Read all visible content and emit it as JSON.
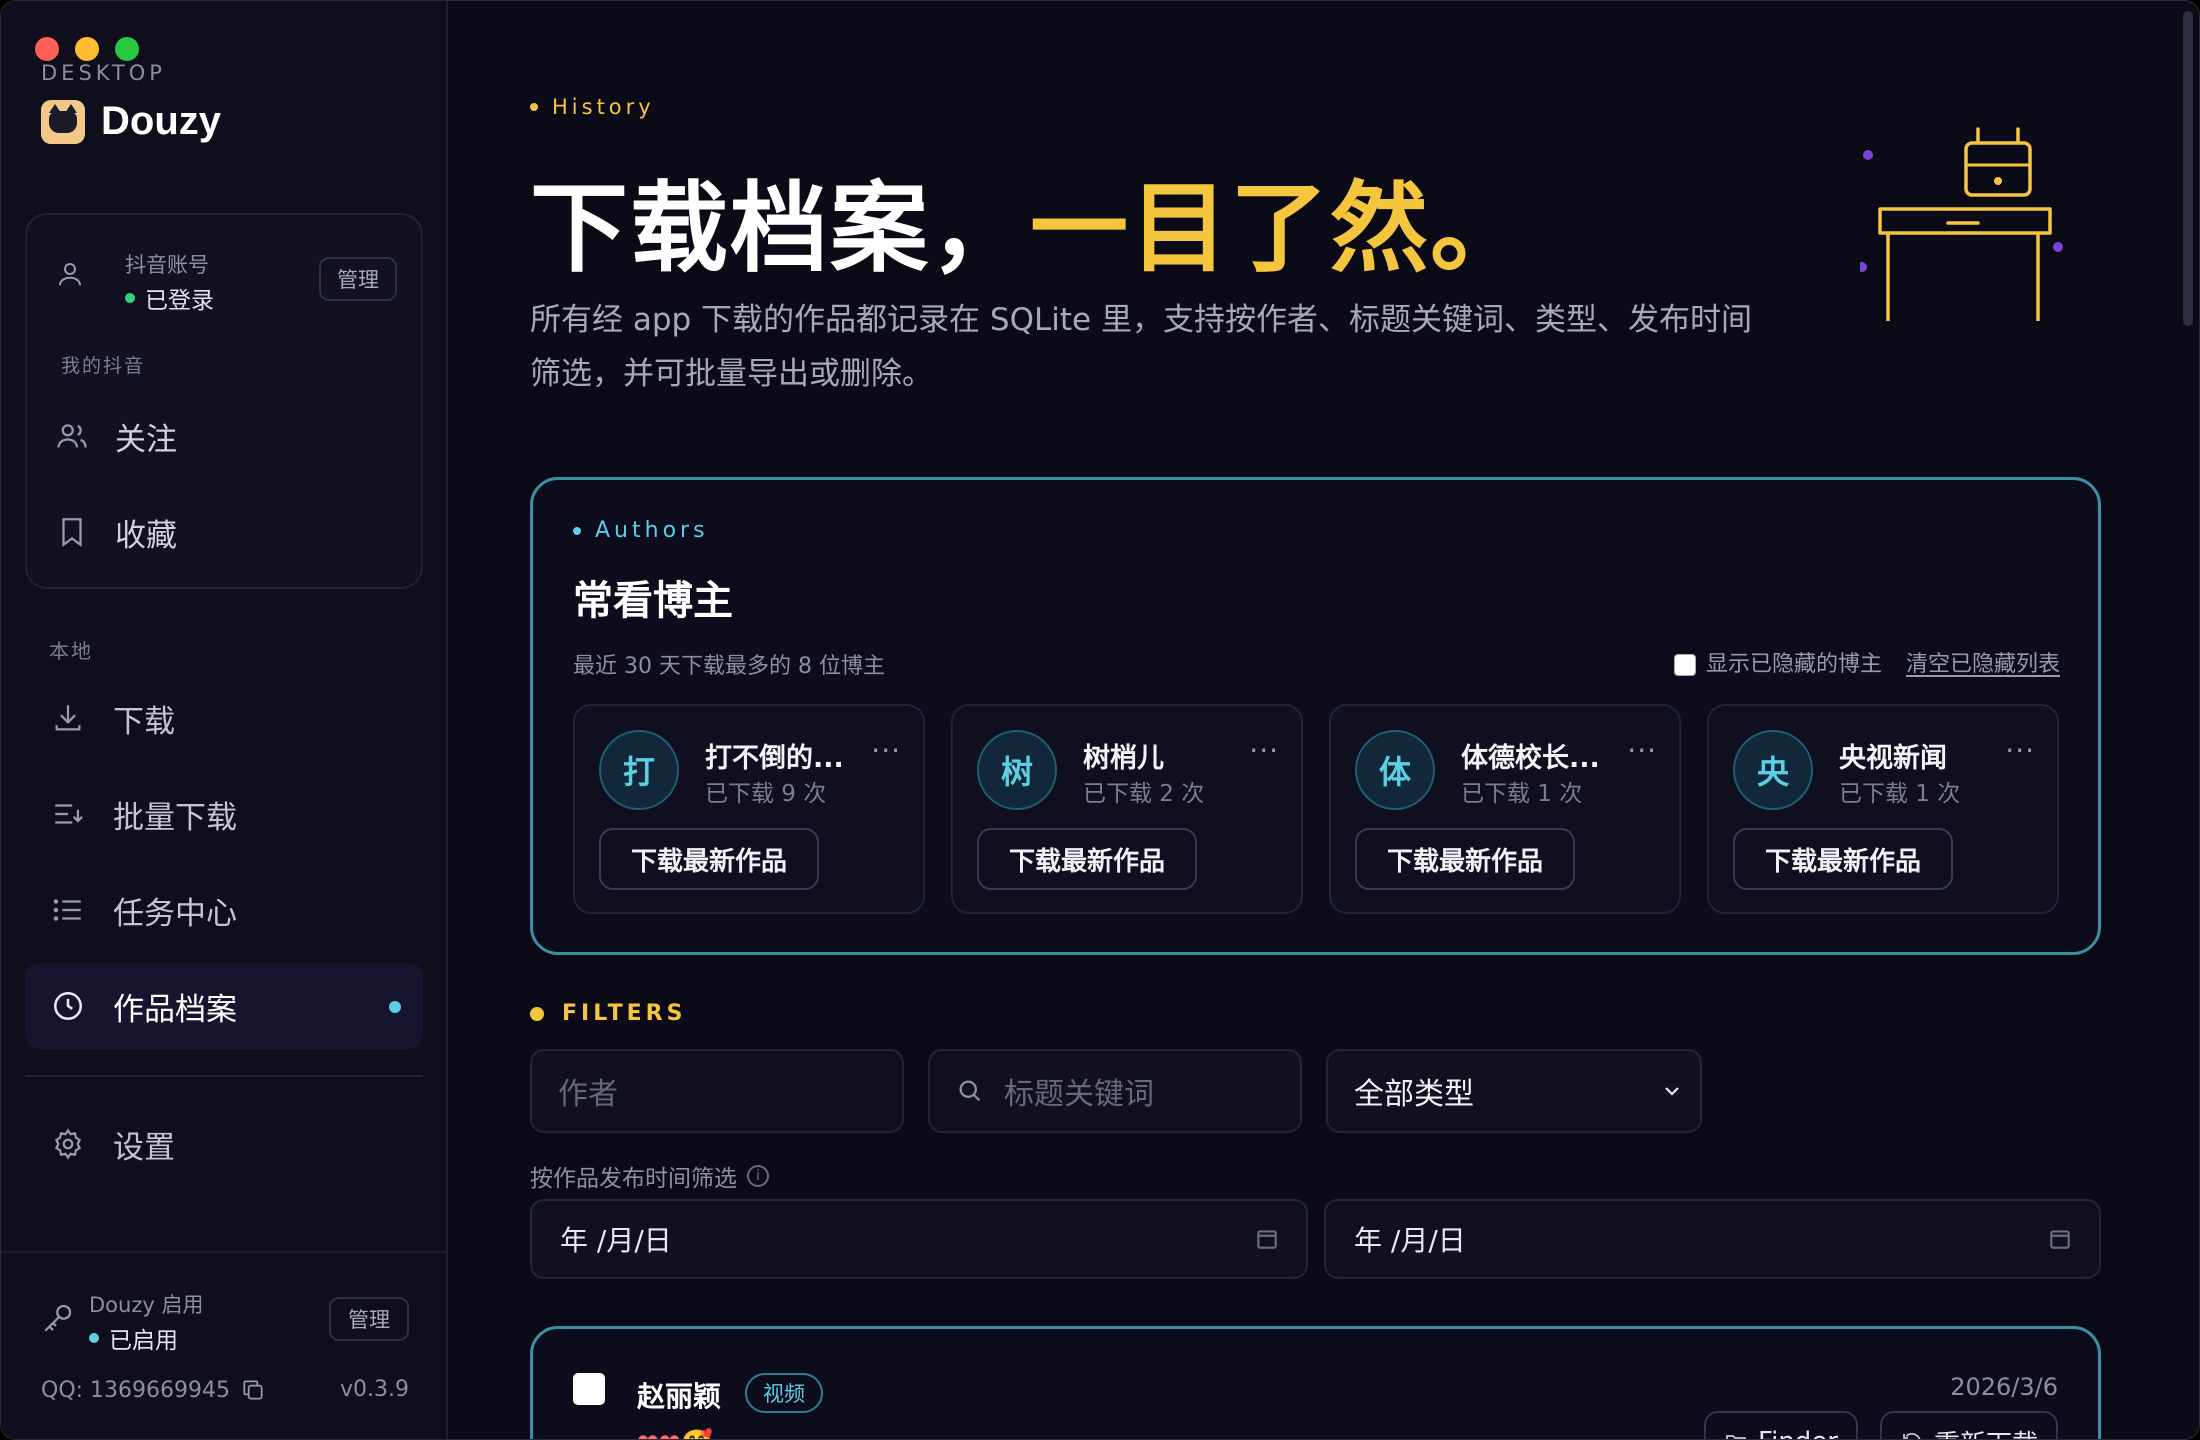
{
  "sidebar": {
    "brand_eyebrow": "DESKTOP",
    "brand_name": "Douzy",
    "account": {
      "label": "抖音账号",
      "status": "已登录",
      "manage_label": "管理",
      "section_label": "我的抖音",
      "items": [
        {
          "label": "关注",
          "icon": "users-icon"
        },
        {
          "label": "收藏",
          "icon": "bookmark-icon"
        }
      ]
    },
    "local_section_label": "本地",
    "nav": [
      {
        "label": "下载",
        "icon": "download-icon"
      },
      {
        "label": "批量下载",
        "icon": "batch-download-icon"
      },
      {
        "label": "任务中心",
        "icon": "list-icon"
      },
      {
        "label": "作品档案",
        "icon": "clock-icon",
        "active": true
      }
    ],
    "settings_label": "设置",
    "license": {
      "label": "Douzy 启用",
      "status": "已启用",
      "manage_label": "管理"
    },
    "qq": "QQ: 1369669945",
    "version": "v0.3.9"
  },
  "hero": {
    "eyebrow": "History",
    "title_main": "下载档案，",
    "title_accent": "一目了然。",
    "description": "所有经 app 下载的作品都记录在 SQLite 里，支持按作者、标题关键词、类型、发布时间筛选，并可批量导出或删除。"
  },
  "authors_panel": {
    "eyebrow": "Authors",
    "title": "常看博主",
    "subtitle": "最近 30 天下载最多的 8 位博主",
    "show_hidden_label": "显示已隐藏的博主",
    "clear_hidden_label": "清空已隐藏列表",
    "download_latest_label": "下载最新作品",
    "more_glyph": "···",
    "authors": [
      {
        "initial": "打",
        "name": "打不倒的...",
        "count": "已下载 9 次"
      },
      {
        "initial": "树",
        "name": "树梢儿",
        "count": "已下载 2 次"
      },
      {
        "initial": "体",
        "name": "体德校长...",
        "count": "已下载 1 次"
      },
      {
        "initial": "央",
        "name": "央视新闻",
        "count": "已下载 1 次"
      }
    ]
  },
  "filters": {
    "eyebrow": "FILTERS",
    "author_placeholder": "作者",
    "keyword_placeholder": "标题关键词",
    "type_selected": "全部类型",
    "date_label": "按作品发布时间筛选",
    "date_placeholder": "年 /月/日"
  },
  "records": [
    {
      "author": "赵丽颖",
      "tag": "视频",
      "emoji": "❤❤🥰",
      "date": "2026/3/6",
      "finder_label": "Finder",
      "redownload_label": "重新下载"
    }
  ],
  "colors": {
    "accent_yellow": "#f4c53d",
    "accent_cyan": "#5ccfe6",
    "background": "#0b0b18",
    "status_green": "#35d07f"
  }
}
